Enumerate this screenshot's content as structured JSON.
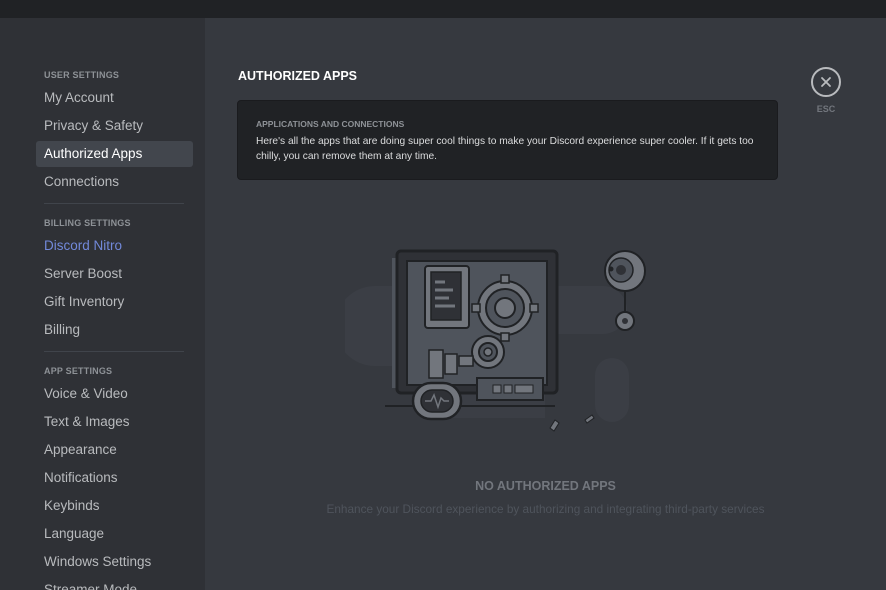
{
  "sidebar": {
    "sections": [
      {
        "header": "User Settings",
        "items": [
          "My Account",
          "Privacy & Safety",
          "Authorized Apps",
          "Connections"
        ]
      },
      {
        "header": "Billing Settings",
        "items": [
          "Discord Nitro",
          "Server Boost",
          "Gift Inventory",
          "Billing"
        ]
      },
      {
        "header": "App Settings",
        "items": [
          "Voice & Video",
          "Text & Images",
          "Appearance",
          "Notifications",
          "Keybinds",
          "Language",
          "Windows Settings",
          "Streamer Mode"
        ]
      }
    ],
    "active_item": "Authorized Apps"
  },
  "main": {
    "title": "AUTHORIZED APPS",
    "info": {
      "heading": "Applications and Connections",
      "body": "Here's all the apps that are doing super cool things to make your Discord experience super cooler. If it gets too chilly, you can remove them at any time."
    },
    "close_label": "ESC",
    "empty_state": {
      "title": "NO AUTHORIZED APPS",
      "description": "Enhance your Discord experience by authorizing and integrating third-party services"
    }
  },
  "colors": {
    "background": "#36393f",
    "sidebar": "#2f3136",
    "titlebar": "#202225",
    "active_item": "#42464d",
    "nitro_accent": "#7289da"
  },
  "icons": [
    "close-icon",
    "robot-illustration"
  ]
}
